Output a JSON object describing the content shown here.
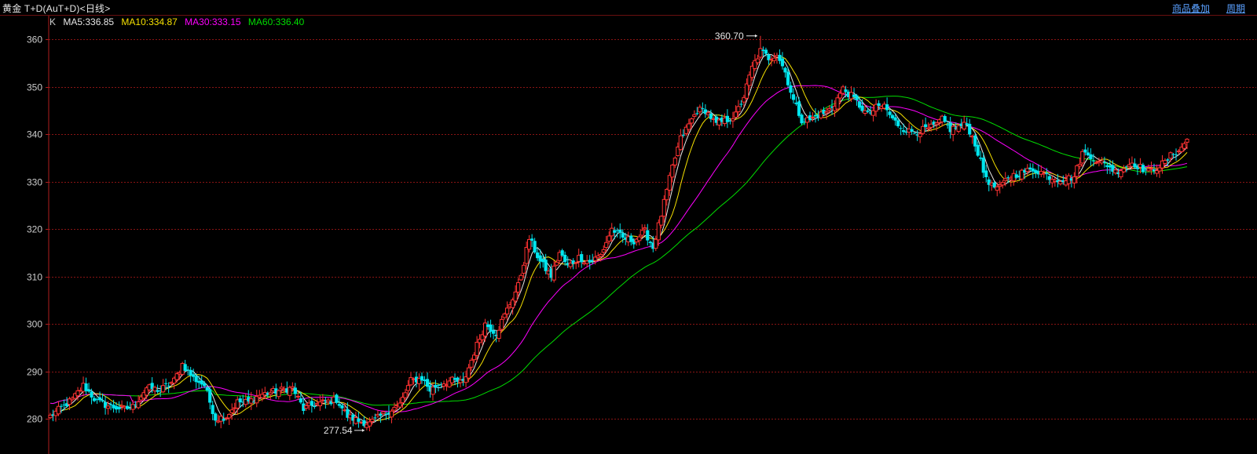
{
  "header": {
    "title": "黄金 T+D(AuT+D)<日线>",
    "overlay_label": "商品叠加",
    "period_label": "周期"
  },
  "indicators": {
    "k_label": "K",
    "ma5": "MA5:336.85",
    "ma10": "MA10:334.87",
    "ma30": "MA30:333.15",
    "ma60": "MA60:336.40"
  },
  "colors": {
    "background": "#000000",
    "up": "#ff3232",
    "down": "#00e5ee",
    "ma5": "#e6e6e6",
    "ma10": "#f5e000",
    "ma30": "#ff00ff",
    "ma60": "#00dd00",
    "grid": "#8a1414",
    "axis_text": "#cccccc"
  },
  "chart_data": {
    "type": "candlestick",
    "y_ticks": [
      280,
      290,
      300,
      310,
      320,
      330,
      340,
      350,
      360
    ],
    "ylim": [
      275.5,
      363.5
    ],
    "annotations": [
      {
        "text": "360.70",
        "value": 360.7
      },
      {
        "text": "277.54",
        "value": 277.54
      }
    ],
    "close_anchors": [
      [
        0,
        280.5
      ],
      [
        8,
        284
      ],
      [
        12,
        287
      ],
      [
        17,
        283.5
      ],
      [
        22,
        282.5
      ],
      [
        27,
        282
      ],
      [
        30,
        282.5
      ],
      [
        35,
        286.5
      ],
      [
        40,
        286
      ],
      [
        45,
        288
      ],
      [
        48,
        291.5
      ],
      [
        52,
        288.5
      ],
      [
        56,
        287
      ],
      [
        60,
        280
      ],
      [
        64,
        280.5
      ],
      [
        68,
        283.5
      ],
      [
        72,
        283.5
      ],
      [
        76,
        285
      ],
      [
        80,
        285.5
      ],
      [
        84,
        286
      ],
      [
        88,
        286.5
      ],
      [
        92,
        282
      ],
      [
        96,
        283
      ],
      [
        100,
        283.5
      ],
      [
        104,
        284
      ],
      [
        108,
        280.5
      ],
      [
        112,
        279.5
      ],
      [
        116,
        279
      ],
      [
        120,
        280.5
      ],
      [
        124,
        282
      ],
      [
        127,
        283
      ],
      [
        131,
        288
      ],
      [
        135,
        288.5
      ],
      [
        138,
        286
      ],
      [
        142,
        287.5
      ],
      [
        146,
        288
      ],
      [
        150,
        287.5
      ],
      [
        154,
        294
      ],
      [
        158,
        300
      ],
      [
        162,
        298
      ],
      [
        166,
        303
      ],
      [
        170,
        308
      ],
      [
        174,
        318
      ],
      [
        178,
        313
      ],
      [
        182,
        310
      ],
      [
        185,
        315
      ],
      [
        188,
        312
      ],
      [
        192,
        314
      ],
      [
        196,
        313
      ],
      [
        200,
        314.5
      ],
      [
        204,
        320
      ],
      [
        208,
        318
      ],
      [
        212,
        317.5
      ],
      [
        216,
        319.5
      ],
      [
        219,
        316
      ],
      [
        222,
        323
      ],
      [
        226,
        333
      ],
      [
        229,
        339
      ],
      [
        232,
        342
      ],
      [
        235,
        345
      ],
      [
        238,
        345
      ],
      [
        242,
        342
      ],
      [
        246,
        343
      ],
      [
        249,
        344
      ],
      [
        252,
        348
      ],
      [
        255,
        354
      ],
      [
        258,
        357.5
      ],
      [
        261,
        356
      ],
      [
        264,
        357
      ],
      [
        267,
        353
      ],
      [
        270,
        347
      ],
      [
        273,
        343
      ],
      [
        276,
        343
      ],
      [
        279,
        344
      ],
      [
        282,
        344.5
      ],
      [
        285,
        346.5
      ],
      [
        288,
        349.5
      ],
      [
        291,
        348
      ],
      [
        294,
        346
      ],
      [
        297,
        344
      ],
      [
        300,
        345.5
      ],
      [
        303,
        346
      ],
      [
        306,
        343
      ],
      [
        309,
        341.5
      ],
      [
        312,
        340.5
      ],
      [
        315,
        340.5
      ],
      [
        318,
        341
      ],
      [
        321,
        341.5
      ],
      [
        324,
        343
      ],
      [
        327,
        341
      ],
      [
        330,
        341.5
      ],
      [
        333,
        342
      ],
      [
        336,
        338
      ],
      [
        339,
        332
      ],
      [
        342,
        329
      ],
      [
        345,
        328.5
      ],
      [
        348,
        331
      ],
      [
        351,
        331.5
      ],
      [
        354,
        332
      ],
      [
        357,
        332.5
      ],
      [
        360,
        332
      ],
      [
        363,
        331
      ],
      [
        366,
        330.5
      ],
      [
        369,
        330.5
      ],
      [
        372,
        331
      ],
      [
        375,
        336
      ],
      [
        378,
        335.5
      ],
      [
        381,
        334
      ],
      [
        384,
        333.5
      ],
      [
        387,
        332
      ],
      [
        390,
        333
      ],
      [
        393,
        334
      ],
      [
        396,
        333
      ],
      [
        399,
        332
      ],
      [
        402,
        333
      ],
      [
        405,
        334
      ],
      [
        408,
        336
      ],
      [
        411,
        337
      ],
      [
        413,
        339
      ]
    ]
  }
}
